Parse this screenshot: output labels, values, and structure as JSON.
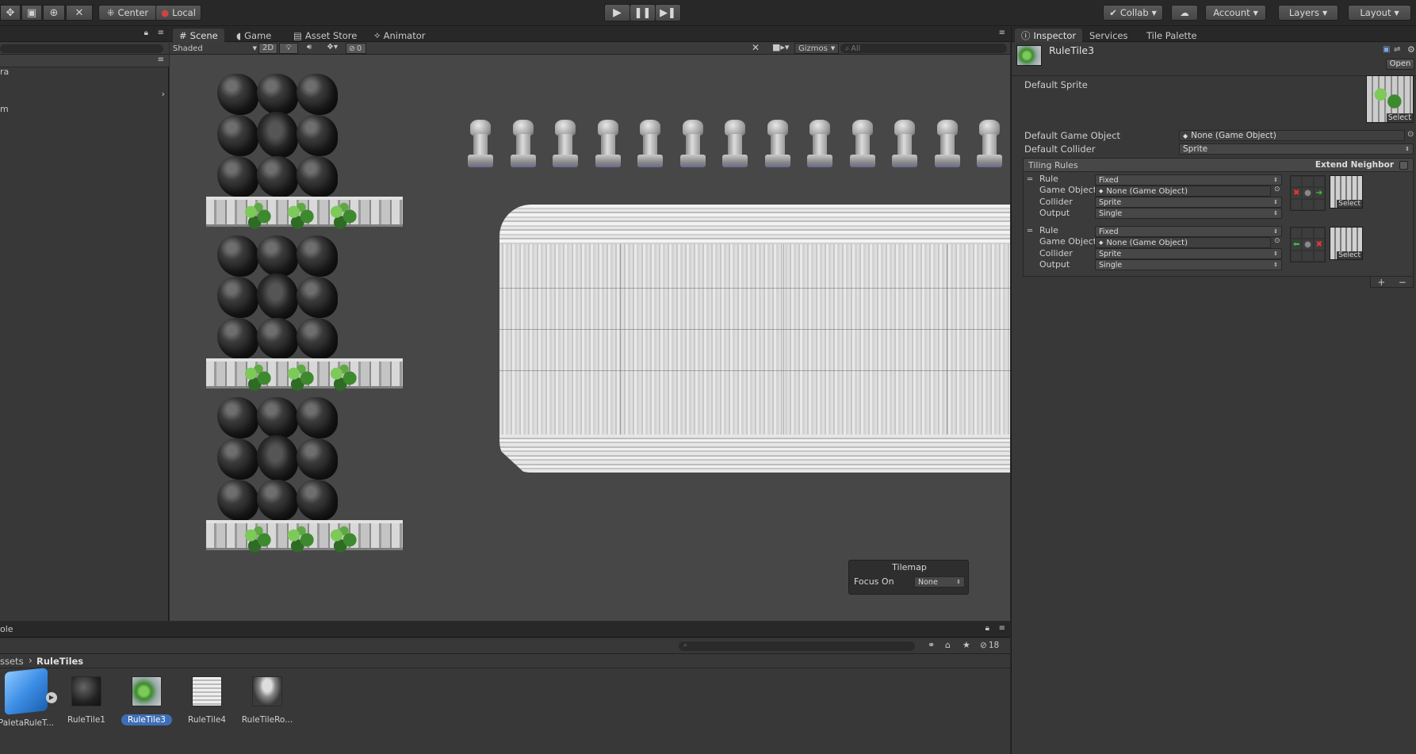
{
  "toolbar": {
    "pivot_label": "Center",
    "space_label": "Local",
    "collab_label": "Collab",
    "account_label": "Account",
    "layers_label": "Layers",
    "layout_label": "Layout"
  },
  "tabs": {
    "scene": "Scene",
    "game": "Game",
    "asset_store": "Asset Store",
    "animator": "Animator",
    "inspector": "Inspector",
    "services": "Services",
    "tile_palette": "Tile Palette"
  },
  "hierarchy": {
    "items": [
      "ra",
      "",
      "m"
    ]
  },
  "scene_toolbar": {
    "draw_mode": "Shaded",
    "mode_2d": "2D",
    "hidden_count": "0",
    "gizmos": "Gizmos",
    "search_placeholder": "All"
  },
  "tilemap_overlay": {
    "title": "Tilemap",
    "focus_label": "Focus On",
    "focus_value": "None"
  },
  "inspector": {
    "object_name": "RuleTile3",
    "open_button": "Open",
    "default_sprite_label": "Default Sprite",
    "select_label": "Select",
    "default_game_object_label": "Default Game Object",
    "default_game_object_value": "None (Game Object)",
    "default_collider_label": "Default Collider",
    "default_collider_value": "Sprite",
    "tiling_rules_label": "Tiling Rules",
    "extend_neighbor_label": "Extend Neighbor",
    "rules": [
      {
        "rule_label": "Rule",
        "rule_value": "Fixed",
        "go_label": "Game Object",
        "go_value": "None (Game Object)",
        "collider_label": "Collider",
        "collider_value": "Sprite",
        "output_label": "Output",
        "output_value": "Single",
        "select_label": "Select"
      },
      {
        "rule_label": "Rule",
        "rule_value": "Fixed",
        "go_label": "Game Object",
        "go_value": "None (Game Object)",
        "collider_label": "Collider",
        "collider_value": "Sprite",
        "output_label": "Output",
        "output_value": "Single",
        "select_label": "Select"
      }
    ],
    "add_symbol": "+",
    "remove_symbol": "−"
  },
  "bottom": {
    "console_tab": "ole",
    "breadcrumb_root": "ssets",
    "breadcrumb_current": "RuleTiles",
    "hidden_count": "18",
    "assets": [
      {
        "name": "PaletaRuleT..."
      },
      {
        "name": "RuleTile1"
      },
      {
        "name": "RuleTile3"
      },
      {
        "name": "RuleTile4"
      },
      {
        "name": "RuleTileRo..."
      }
    ]
  },
  "colors": {
    "selection": "#3e6fb5",
    "panel": "#383838",
    "scene_bg": "#474747"
  }
}
